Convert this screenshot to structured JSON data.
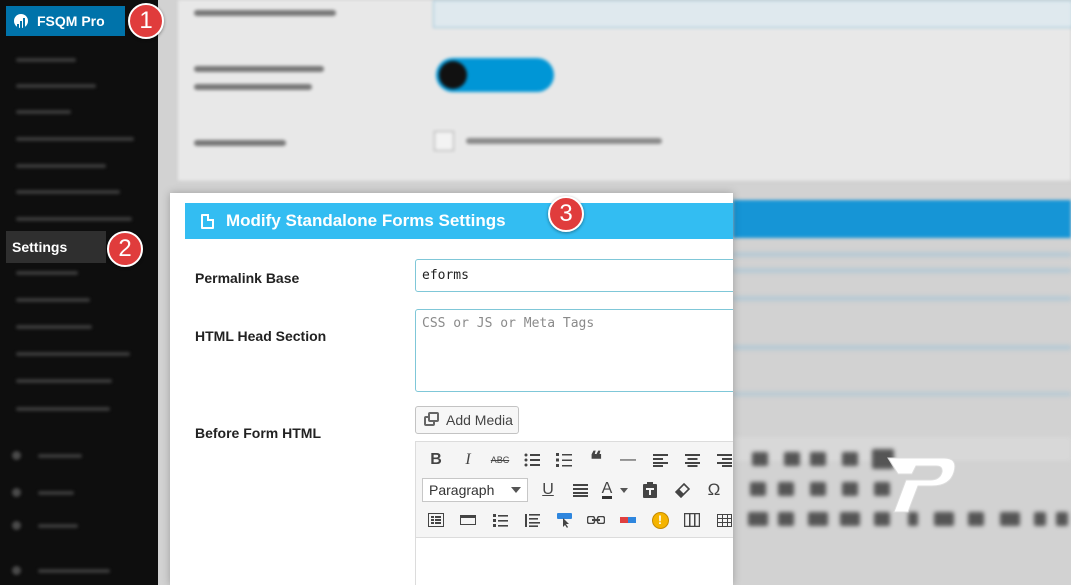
{
  "sidebar": {
    "menu_top_label": "FSQM Pro",
    "settings_label": "Settings"
  },
  "badges": [
    "1",
    "2",
    "3"
  ],
  "panel": {
    "title": "Modify Standalone Forms Settings",
    "permalink_label": "Permalink Base",
    "permalink_value": "eforms",
    "head_label": "HTML Head Section",
    "head_placeholder": "CSS or JS or Meta Tags",
    "before_form_label": "Before Form HTML",
    "add_media_label": "Add Media",
    "format_select_value": "Paragraph"
  },
  "toolbar_glyphs": {
    "bold": "B",
    "italic": "I",
    "strike": "ABC",
    "blockquote": "❝",
    "hr": "—",
    "underline": "U",
    "text_color": "A",
    "special_char": "Ω",
    "highlight": "!"
  },
  "colors": {
    "admin_sidebar": "#0e0e0e",
    "menu_active": "#0073aa",
    "panel_header": "#33bdf2",
    "badge": "#e03c3c",
    "input_border": "#7fc7d8"
  }
}
